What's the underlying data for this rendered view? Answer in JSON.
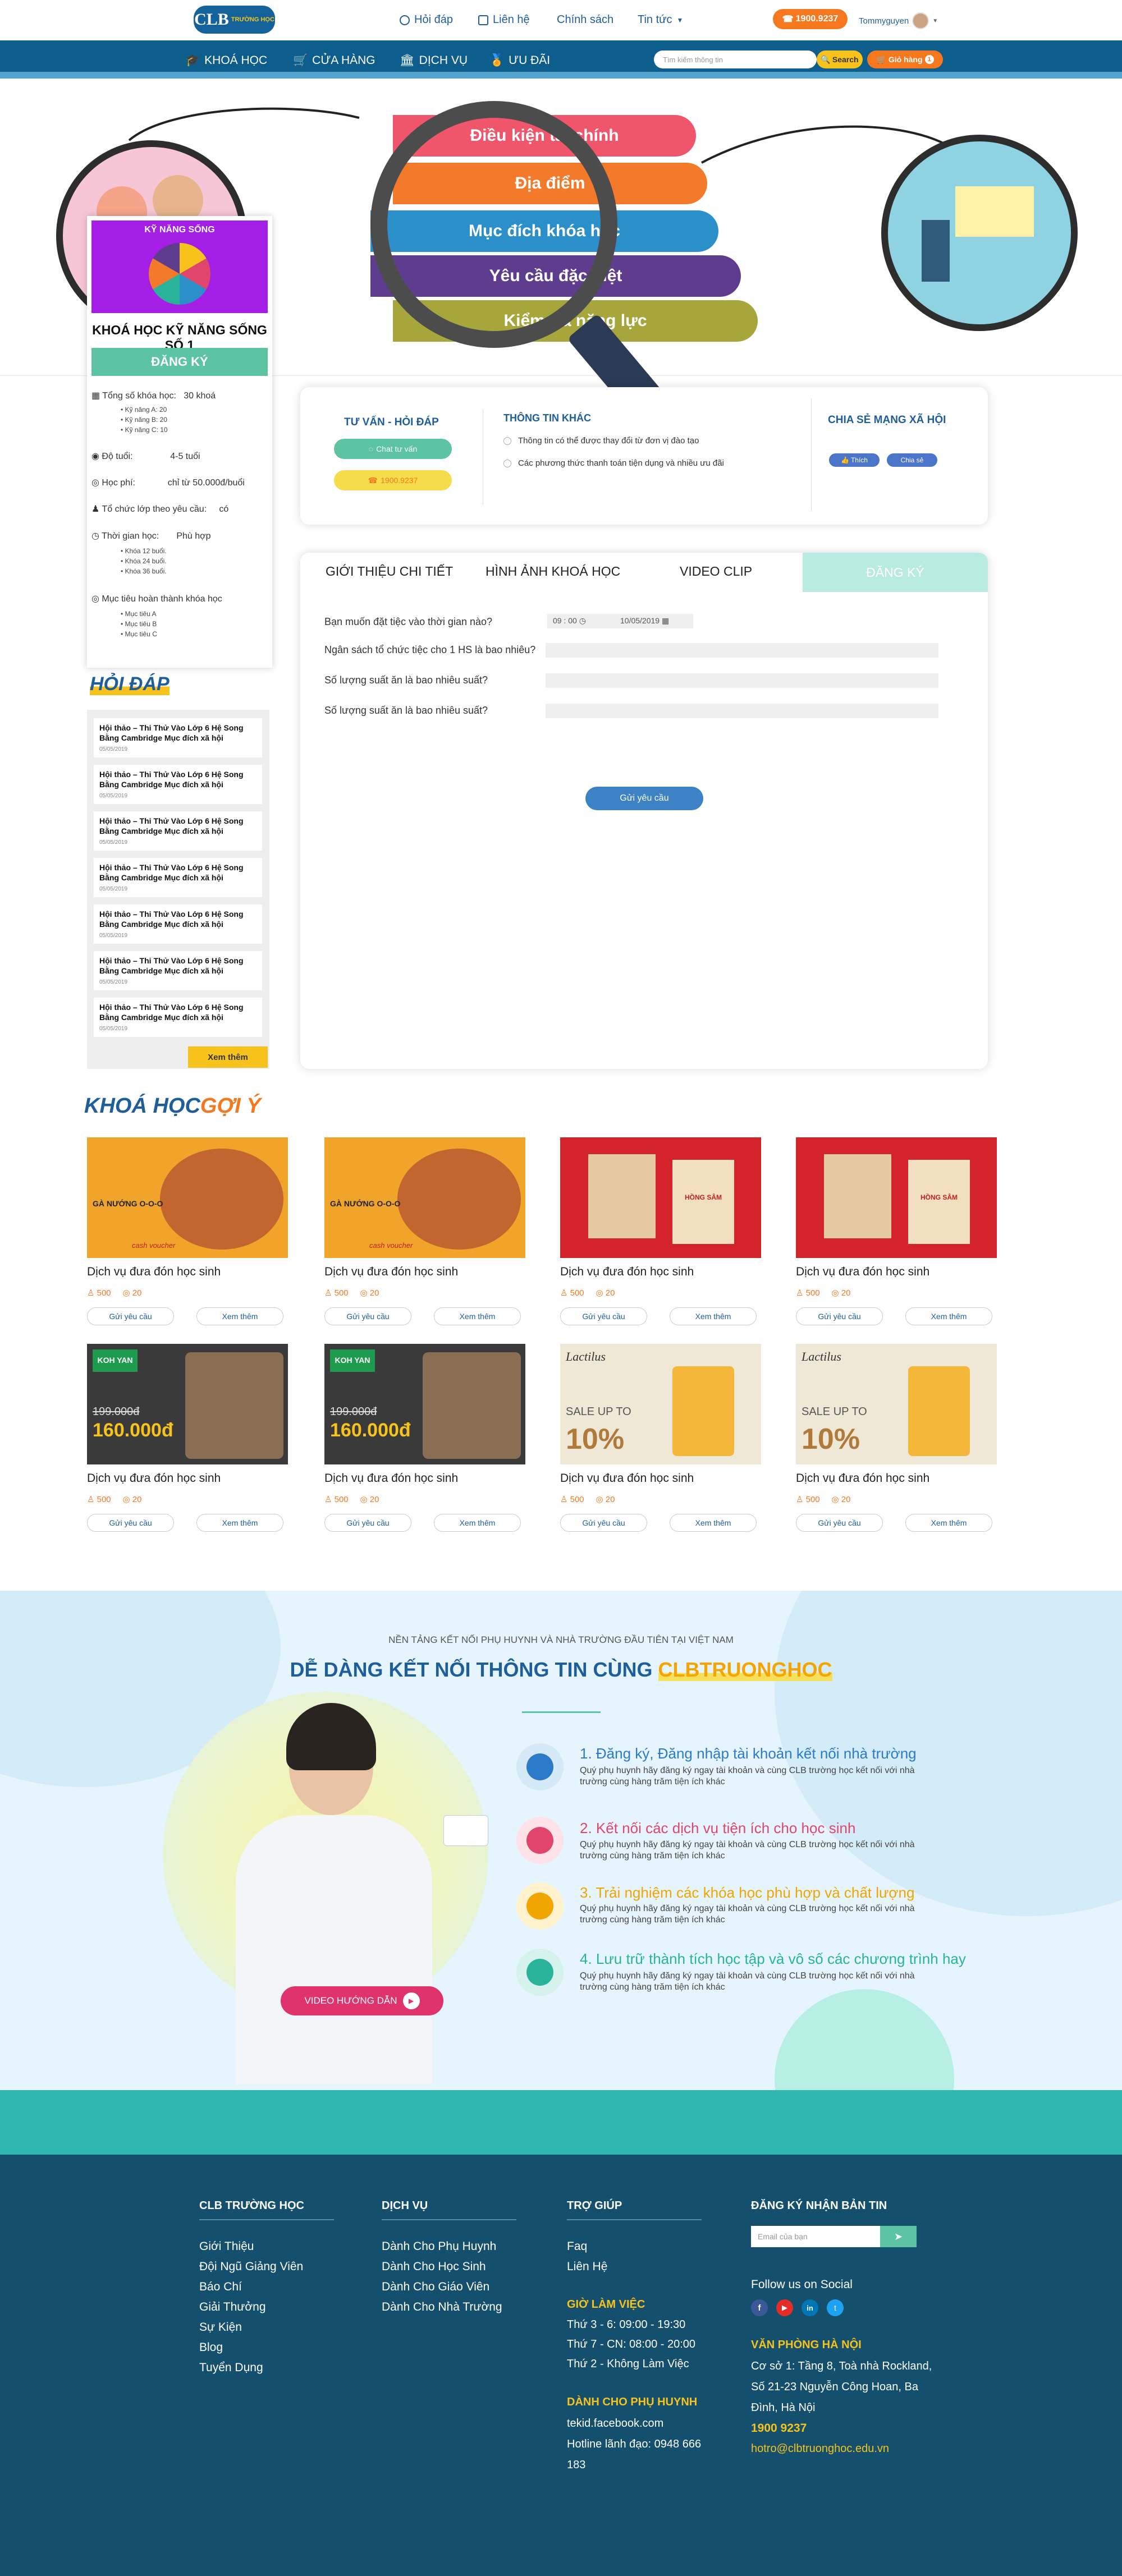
{
  "header": {
    "logo_text": "CLB",
    "logo_sub": "TRƯỜNG HỌC",
    "links": [
      "Hỏi đáp",
      "Liên hệ",
      "Chính sách",
      "Tin tức"
    ],
    "phone": "1900.9237",
    "username": "Tommyguyen"
  },
  "nav": {
    "items": [
      "KHOÁ HỌC",
      "CỬA HÀNG",
      "DỊCH VỤ",
      "ƯU ĐÃI"
    ],
    "search_placeholder": "Tìm kiếm thông tin",
    "search_label": "Search",
    "cart_label": "Giỏ hàng",
    "cart_count": "1"
  },
  "hero": {
    "bars": [
      "Điều kiện tài chính",
      "Địa điểm",
      "Mục đích khóa học",
      "Yêu cầu đặc biệt",
      "Kiểm tra năng lực"
    ]
  },
  "course": {
    "image_title": "KỸ NĂNG SỐNG",
    "title": "KHOÁ HỌC KỸ NĂNG SỐNG SỐ 1",
    "register": "ĐĂNG KÝ",
    "rows": [
      {
        "label": "Tổng số khóa học:",
        "value": "30 khoá"
      },
      {
        "label": "Độ tuổi:",
        "value": "4-5 tuổi"
      },
      {
        "label": "Học phí:",
        "value": "chỉ từ 50.000đ/buổi"
      },
      {
        "label": "Tổ chức lớp theo yêu cầu:",
        "value": "có"
      },
      {
        "label": "Thời gian học:",
        "value": "Phù hợp"
      },
      {
        "label": "Mục tiêu hoàn thành khóa học",
        "value": ""
      }
    ],
    "skills": [
      "• Kỹ năng A: 20",
      "• Kỹ năng B: 20",
      "• Kỹ năng C: 10"
    ],
    "durations": [
      "• Khóa 12 buổi.",
      "• Khóa 24 buổi.",
      "• Khóa 36 buổi."
    ],
    "goals": [
      "• Mục tiêu A",
      "• Mục tiêu B",
      "• Mục tiêu C"
    ]
  },
  "consult": {
    "title": "TƯ VẤN - HỎI ĐÁP",
    "chat": "Chat tư vấn",
    "phone": "1900.9237",
    "other_title": "THÔNG TIN KHÁC",
    "other": [
      "Thông tin có thể được thay đổi từ đơn vị đào tạo",
      "Các phương thức thanh toán tiện dụng và nhiều ưu đãi"
    ],
    "social_title": "CHIA SẺ MẠNG XÃ HỘI",
    "like": "Thích",
    "share": "Chia sẻ"
  },
  "tabs": [
    "GIỚI THIỆU CHI TIẾT",
    "HÌNH ẢNH KHOÁ HỌC",
    "VIDEO CLIP",
    "ĐĂNG KÝ"
  ],
  "form": {
    "q1": "Bạn muốn đặt tiệc vào thời gian nào?",
    "time": "09 : 00",
    "date": "10/05/2019",
    "q2": "Ngân sách tổ chức tiệc cho 1 HS là bao nhiêu?",
    "q3": "Số lượng suất ăn là bao nhiêu suất?",
    "q4": "Số lượng suất ăn là bao nhiêu suất?",
    "submit": "Gửi yêu cầu"
  },
  "faq": {
    "title": "HỎI ĐÁP",
    "item_title": "Hội thảo – Thi Thử Vào Lớp 6 Hệ Song Bằng Cambridge Mục đích xã hội",
    "item_date": "05/05/2019",
    "more": "Xem thêm"
  },
  "suggest": {
    "title_a": "KHOÁ HỌC",
    "title_b": "GỢI Ý",
    "product_name": "Dịch vụ đưa đón học sinh",
    "views": "500",
    "comments": "20",
    "btn_request": "Gửi yêu cầu",
    "btn_more": "Xem thêm",
    "img_labels": [
      "GÀ NƯỚNG O-O-O",
      "cash voucher",
      "HỒNG SÂM",
      "KOH YAN",
      "199.000đ",
      "160.000đ",
      "Lactilus",
      "SALE UP TO",
      "10%"
    ]
  },
  "connect": {
    "kicker": "NỀN TẢNG KẾT NỐI PHỤ HUYNH VÀ NHÀ TRƯỜNG ĐẦU TIÊN TẠI VIỆT NAM",
    "title_a": "DỄ DÀNG KẾT NỐI THÔNG TIN CÙNG",
    "title_b": "CLBTRUONGHOC",
    "video": "VIDEO HƯỚNG DẪN",
    "steps": [
      {
        "title": "1. Đăng ký, Đăng nhập tài khoản kết nối nhà trường",
        "color": "#2b7bc8"
      },
      {
        "title": "2. Kết nối các dịch vụ tiện ích cho học sinh",
        "color": "#e0466b"
      },
      {
        "title": "3. Trải nghiệm các khóa học phù hợp và chất lượng",
        "color": "#f0a500"
      },
      {
        "title": "4. Lưu trữ thành tích học tập và vô số các chương trình hay",
        "color": "#29b39b"
      }
    ],
    "step_desc": "Quý phụ huynh hãy đăng ký ngay tài khoản và cùng CLB trường học kết nối với nhà trường cùng hàng trăm tiện ích khác"
  },
  "footer": {
    "col1_title": "CLB TRƯỜNG HỌC",
    "col1": [
      "Giới Thiệu",
      "Đội Ngũ Giảng Viên",
      "Báo Chí",
      "Giải Thưởng",
      "Sự Kiện",
      "Blog",
      "Tuyển Dụng"
    ],
    "col2_title": "DỊCH VỤ",
    "col2": [
      "Dành Cho Phụ Huynh",
      "Dành Cho Học Sinh",
      "Dành Cho Giáo Viên",
      "Dành Cho Nhà Trường"
    ],
    "col3_title": "TRỢ GIÚP",
    "col3": [
      "Faq",
      "Liên Hệ"
    ],
    "hours_title": "GIỜ LÀM VIỆC",
    "hours": [
      "Thứ 3 - 6: 09:00 - 19:30",
      "Thứ 7 - CN: 08:00 - 20:00",
      "Thứ 2 - Không Làm Việc"
    ],
    "parents_title": "DÀNH CHO PHỤ HUYNH",
    "parents": [
      "tekid.facebook.com",
      "Hotline lãnh đạo: 0948 666",
      "183"
    ],
    "news_title": "ĐĂNG KÝ NHẬN BẢN TIN",
    "email_placeholder": "Email của bạn",
    "follow": "Follow us on Social",
    "office_title": "VĂN PHÒNG HÀ NỘI",
    "office": [
      "Cơ sở 1: Tầng 8, Toà nhà Rockland,",
      "Số 21-23 Nguyễn Công Hoan, Ba",
      "Đình, Hà Nội"
    ],
    "office_phone": "1900 9237",
    "office_email": "hotro@clbtruonghoc.edu.vn"
  }
}
